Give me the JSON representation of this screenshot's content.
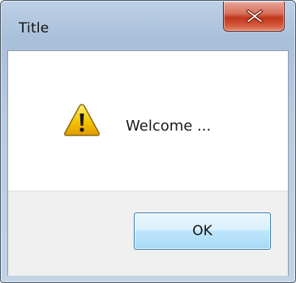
{
  "window": {
    "title": "Title"
  },
  "title_bar": {
    "close_icon": "close-icon"
  },
  "dialog": {
    "icon": "warning-icon",
    "message": "Welcome ...",
    "ok_label": "OK"
  },
  "colors": {
    "close_button": "#c1371c",
    "ok_button_border": "#3c7fb1",
    "footer_background": "#f0f0f0",
    "warning_yellow": "#f5c400"
  }
}
